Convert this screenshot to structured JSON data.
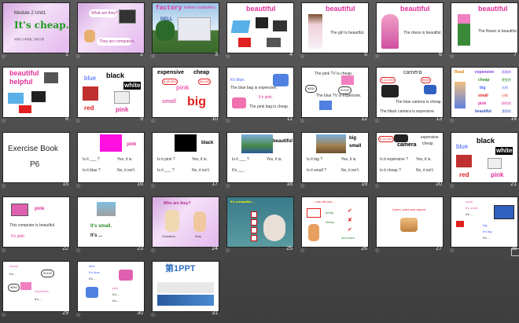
{
  "slides": [
    {
      "n": "1",
      "title1": "Module 2 Unit1",
      "title2": "It's cheap.",
      "sub": "外研社·小学英语·三年级下册"
    },
    {
      "n": "2",
      "q": "What are they?",
      "a": "They are computers."
    },
    {
      "n": "3",
      "word1": "factory",
      "word2": "makes computers",
      "brand": "DELL"
    },
    {
      "n": "4",
      "word": "beautiful"
    },
    {
      "n": "5",
      "word": "beautiful",
      "sent": "The girl is beautiful."
    },
    {
      "n": "6",
      "word": "beautiful",
      "sent": "The dress is beautiful."
    },
    {
      "n": "7",
      "word": "beautiful",
      "sent": "The flower is beautiful."
    },
    {
      "n": "8",
      "w1": "beautiful",
      "w2": "helpful"
    },
    {
      "n": "9",
      "blue": "blue",
      "black": "black",
      "white": "white",
      "red": "red",
      "pink": "pink"
    },
    {
      "n": "10",
      "exp": "expensive",
      "cheap": "cheap",
      "pink": "pink",
      "small": "small",
      "big": "big",
      "p1": "¥ 25,000",
      "p2": "¥5,000"
    },
    {
      "n": "11",
      "l1": "It's blue.",
      "l2": "The blue bag is expensive.",
      "l3": "It's pink.",
      "l4": "The pink bag is cheap."
    },
    {
      "n": "12",
      "l1": "The pink TV is cheap.",
      "l2": "The blue TV is expensive.",
      "p1": "¥850",
      "p2": "¥2100"
    },
    {
      "n": "13",
      "cam": "camera",
      "l1": "The blue camera is cheap.",
      "l2": "The black camera is expensive.",
      "p1": "¥ 22,000",
      "p2": "¥800"
    },
    {
      "n": "14",
      "words": [
        "expensive",
        "cheap",
        "big",
        "small",
        "pink",
        "beautiful"
      ],
      "cn": [
        "昂贵的",
        "便宜的",
        "大的",
        "小的",
        "粉色的",
        "漂亮的"
      ],
      "read": "Read"
    },
    {
      "n": "15",
      "l1": "Exercise Book",
      "l2": "P6"
    },
    {
      "n": "16",
      "col": "pink",
      "q1": "Is it ___ ?",
      "a1": "Yes, it is.",
      "q2": "Is it blue ?",
      "a2": "No, it isn't."
    },
    {
      "n": "17",
      "col": "black",
      "q1": "Is it pink ?",
      "a1": "Yes, it is.",
      "q2": "Is it ___ ?",
      "a2": "No, it isn't."
    },
    {
      "n": "18",
      "word": "beautiful",
      "q1": "Is it ___ ?",
      "a1": "Yes, it is.",
      "q2": "It's ___ ."
    },
    {
      "n": "19",
      "w1": "big",
      "w2": "small",
      "q1": "Is it big ?",
      "a1": "Yes, it is.",
      "q2": "Is it small ?",
      "a2": "No, it isn't."
    },
    {
      "n": "20",
      "w1": "camera",
      "w2": "expensive",
      "w3": "cheap",
      "q1": "Is it expensive ?",
      "a1": "Yes, it is.",
      "q2": "Is it cheap ?",
      "a2": "No, it isn't.",
      "p1": "¥ 22,000",
      "p2": "¥800"
    },
    {
      "n": "21",
      "blue": "blue",
      "black": "black",
      "white": "white",
      "red": "red",
      "pink": "pink"
    },
    {
      "n": "22",
      "col": "pink",
      "s1": "This computer is beautiful.",
      "s2": "It's pink."
    },
    {
      "n": "23",
      "s1": "It's small.",
      "s2": "It's ..."
    },
    {
      "n": "24",
      "q": "Who are they?",
      "a1": "Grandma",
      "a2": "Amy"
    },
    {
      "n": "25",
      "t": "It's a beautiful ..."
    },
    {
      "n": "26",
      "t": "I can tell you ...",
      "w1": "pretty",
      "w2": "cheap",
      "w3": "and more."
    },
    {
      "n": "27",
      "t": "Listen, point and repeat."
    },
    {
      "n": "28",
      "l1": "small",
      "l2": "It's small.",
      "l3": "It's ...",
      "l4": "big",
      "l5": "It's big.",
      "l6": "It's ..."
    },
    {
      "n": "29",
      "l1": "cheap",
      "l2": "It's ...",
      "l3": "expensive",
      "l4": "It's ...",
      "p1": "¥850",
      "p2": "¥2100"
    },
    {
      "n": "30",
      "l1": "blue",
      "l2": "It's blue.",
      "l3": "It's ...",
      "l4": "pink",
      "l5": "It's ...",
      "l6": "It's ..."
    },
    {
      "n": "31",
      "brand": "第1PPT"
    }
  ],
  "icons": {
    "slide_marker": "star-icon",
    "view_toggle": "slide-sorter-icon"
  }
}
